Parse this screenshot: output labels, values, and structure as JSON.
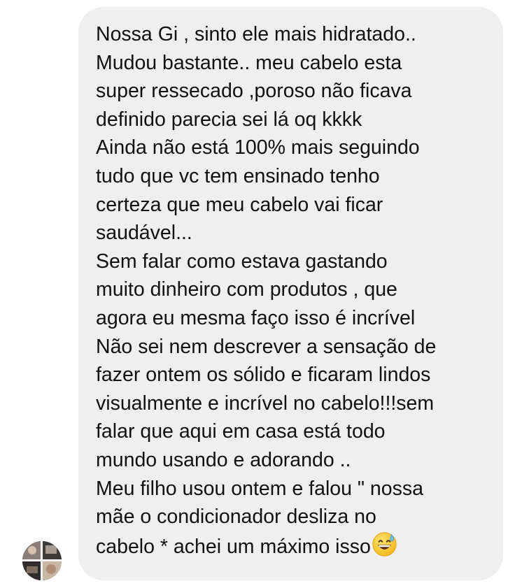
{
  "message": {
    "lines": [
      "Nossa Gi , sinto ele mais hidratado..",
      "Mudou bastante.. meu cabelo esta",
      "super ressecado ,poroso não ficava",
      "definido parecia sei lá oq kkkk",
      "Ainda não está 100% mais seguindo",
      "tudo que vc tem ensinado tenho",
      "certeza que meu cabelo vai ficar",
      "saudável...",
      "Sem falar como estava gastando",
      "muito dinheiro com produtos , que",
      "agora eu mesma faço isso é incrível",
      "Não sei nem descrever a sensação de",
      "fazer ontem os sólido e ficaram lindos",
      "visualmente e incrível no cabelo!!!sem",
      "falar que aqui em casa está todo",
      "mundo  usando e adorando ..",
      "Meu filho usou ontem e falou \" nossa",
      "mãe o condicionador desliza no",
      "cabelo * achei um máximo isso"
    ],
    "trailing_emoji": "grinning-face-with-sweat"
  },
  "colors": {
    "bubble_background": "#efefef",
    "text": "#111111",
    "page_background": "#ffffff"
  }
}
